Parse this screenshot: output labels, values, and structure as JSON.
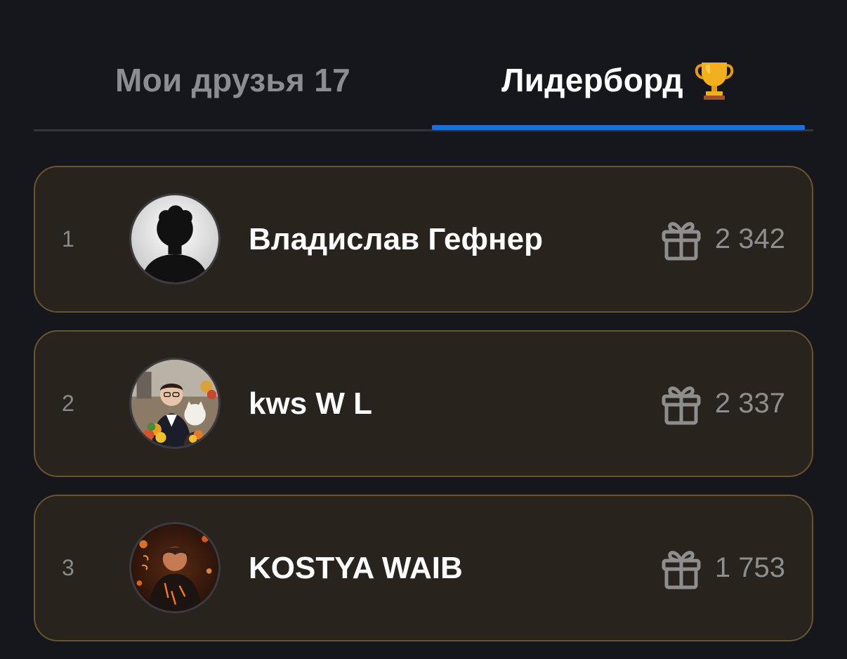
{
  "tabs": {
    "friends_label": "Мои друзья 17",
    "leaderboard_label": "Лидерборд"
  },
  "leaderboard": [
    {
      "rank": "1",
      "name": "Владислав Гефнер",
      "score": "2 342",
      "avatar": "silhouette-avatar"
    },
    {
      "rank": "2",
      "name": "kws W L",
      "score": "2 337",
      "avatar": "photo-avatar"
    },
    {
      "rank": "3",
      "name": "KOSTYA WAIB",
      "score": "1 753",
      "avatar": "photo-avatar"
    }
  ],
  "colors": {
    "background": "#16171c",
    "card_background": "#28231d",
    "card_border": "#6a5430",
    "accent": "#1a6fdb",
    "trophy": "#f2b01e"
  },
  "icons": {
    "trophy": "trophy-icon",
    "gift": "gift-icon"
  }
}
